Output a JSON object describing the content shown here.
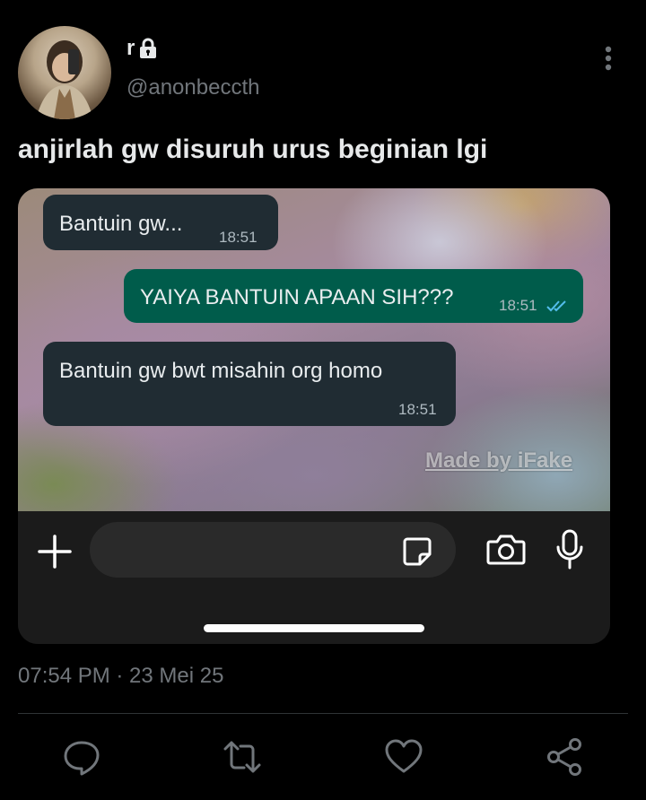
{
  "author": {
    "name": "r",
    "handle": "@anonbeccth",
    "protected_icon": "lock-icon"
  },
  "tweet": {
    "text": "anjirlah gw disuruh urus beginian lgi",
    "timestamp": "07:54 PM · 23 Mei 25"
  },
  "chat": {
    "messages": [
      {
        "direction": "incoming",
        "text": "Bantuin gw...",
        "time": "18:51"
      },
      {
        "direction": "outgoing",
        "text": "YAIYA BANTUIN APAAN SIH???",
        "time": "18:51",
        "status": "read"
      },
      {
        "direction": "incoming",
        "text": "Bantuin gw bwt misahin org homo",
        "time": "18:51"
      }
    ],
    "watermark": "Made by iFake",
    "composer_icons": [
      "plus-icon",
      "sticker-icon",
      "camera-icon",
      "mic-icon"
    ]
  },
  "actions": [
    "reply-icon",
    "retweet-icon",
    "like-icon",
    "share-icon"
  ],
  "colors": {
    "background": "#000000",
    "text": "#e7e9ea",
    "secondary_text": "#71767b",
    "incoming_bubble": "#202c33",
    "outgoing_bubble": "#005c4b",
    "read_ticks": "#53bdeb"
  }
}
